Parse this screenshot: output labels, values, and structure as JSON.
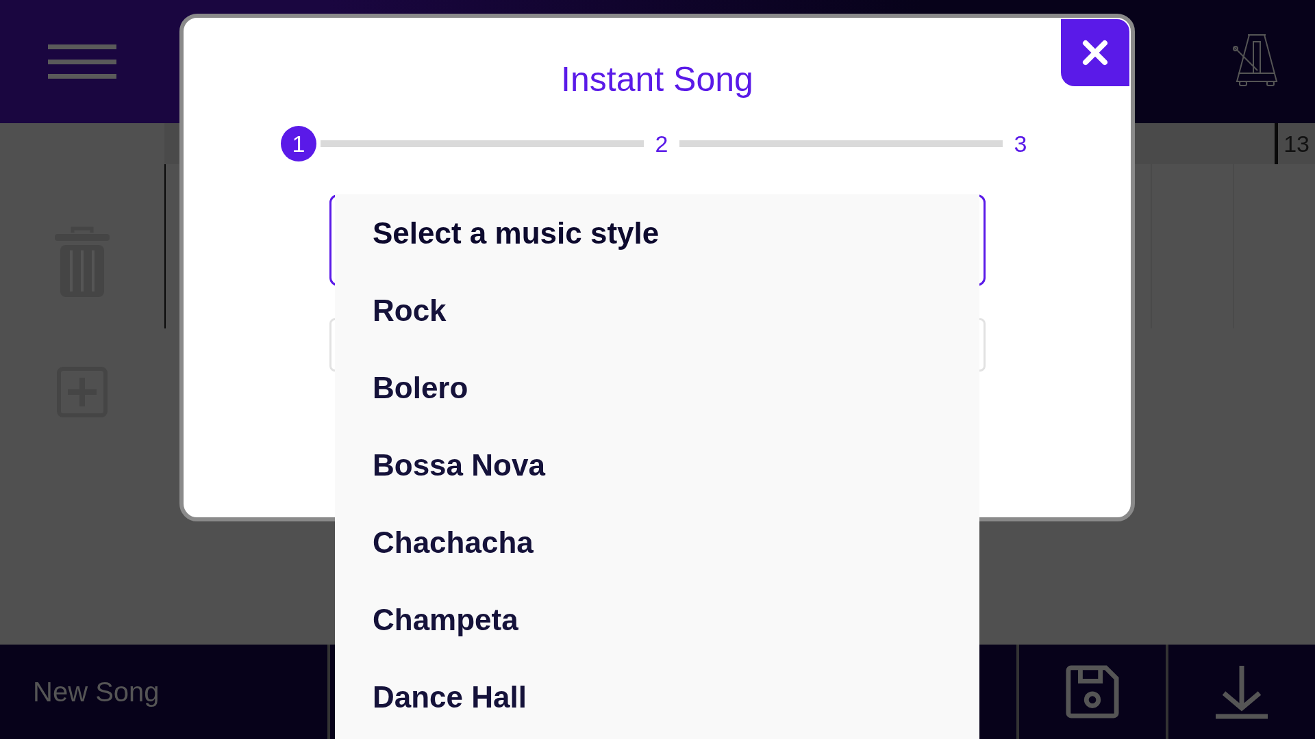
{
  "app": {
    "song_name": "New Song",
    "measure_number": "13"
  },
  "dialog": {
    "title": "Instant Song",
    "steps": [
      {
        "label": "1",
        "selected": true
      },
      {
        "label": "2",
        "selected": false
      },
      {
        "label": "3",
        "selected": false
      }
    ],
    "style_menu": {
      "options": [
        {
          "label": "Select a music style",
          "selected": true
        },
        {
          "label": "Rock",
          "selected": false
        },
        {
          "label": "Bolero",
          "selected": false
        },
        {
          "label": "Bossa Nova",
          "selected": false
        },
        {
          "label": "Chachacha",
          "selected": false
        },
        {
          "label": "Champeta",
          "selected": false
        },
        {
          "label": "Dance Hall",
          "selected": false
        }
      ]
    }
  }
}
